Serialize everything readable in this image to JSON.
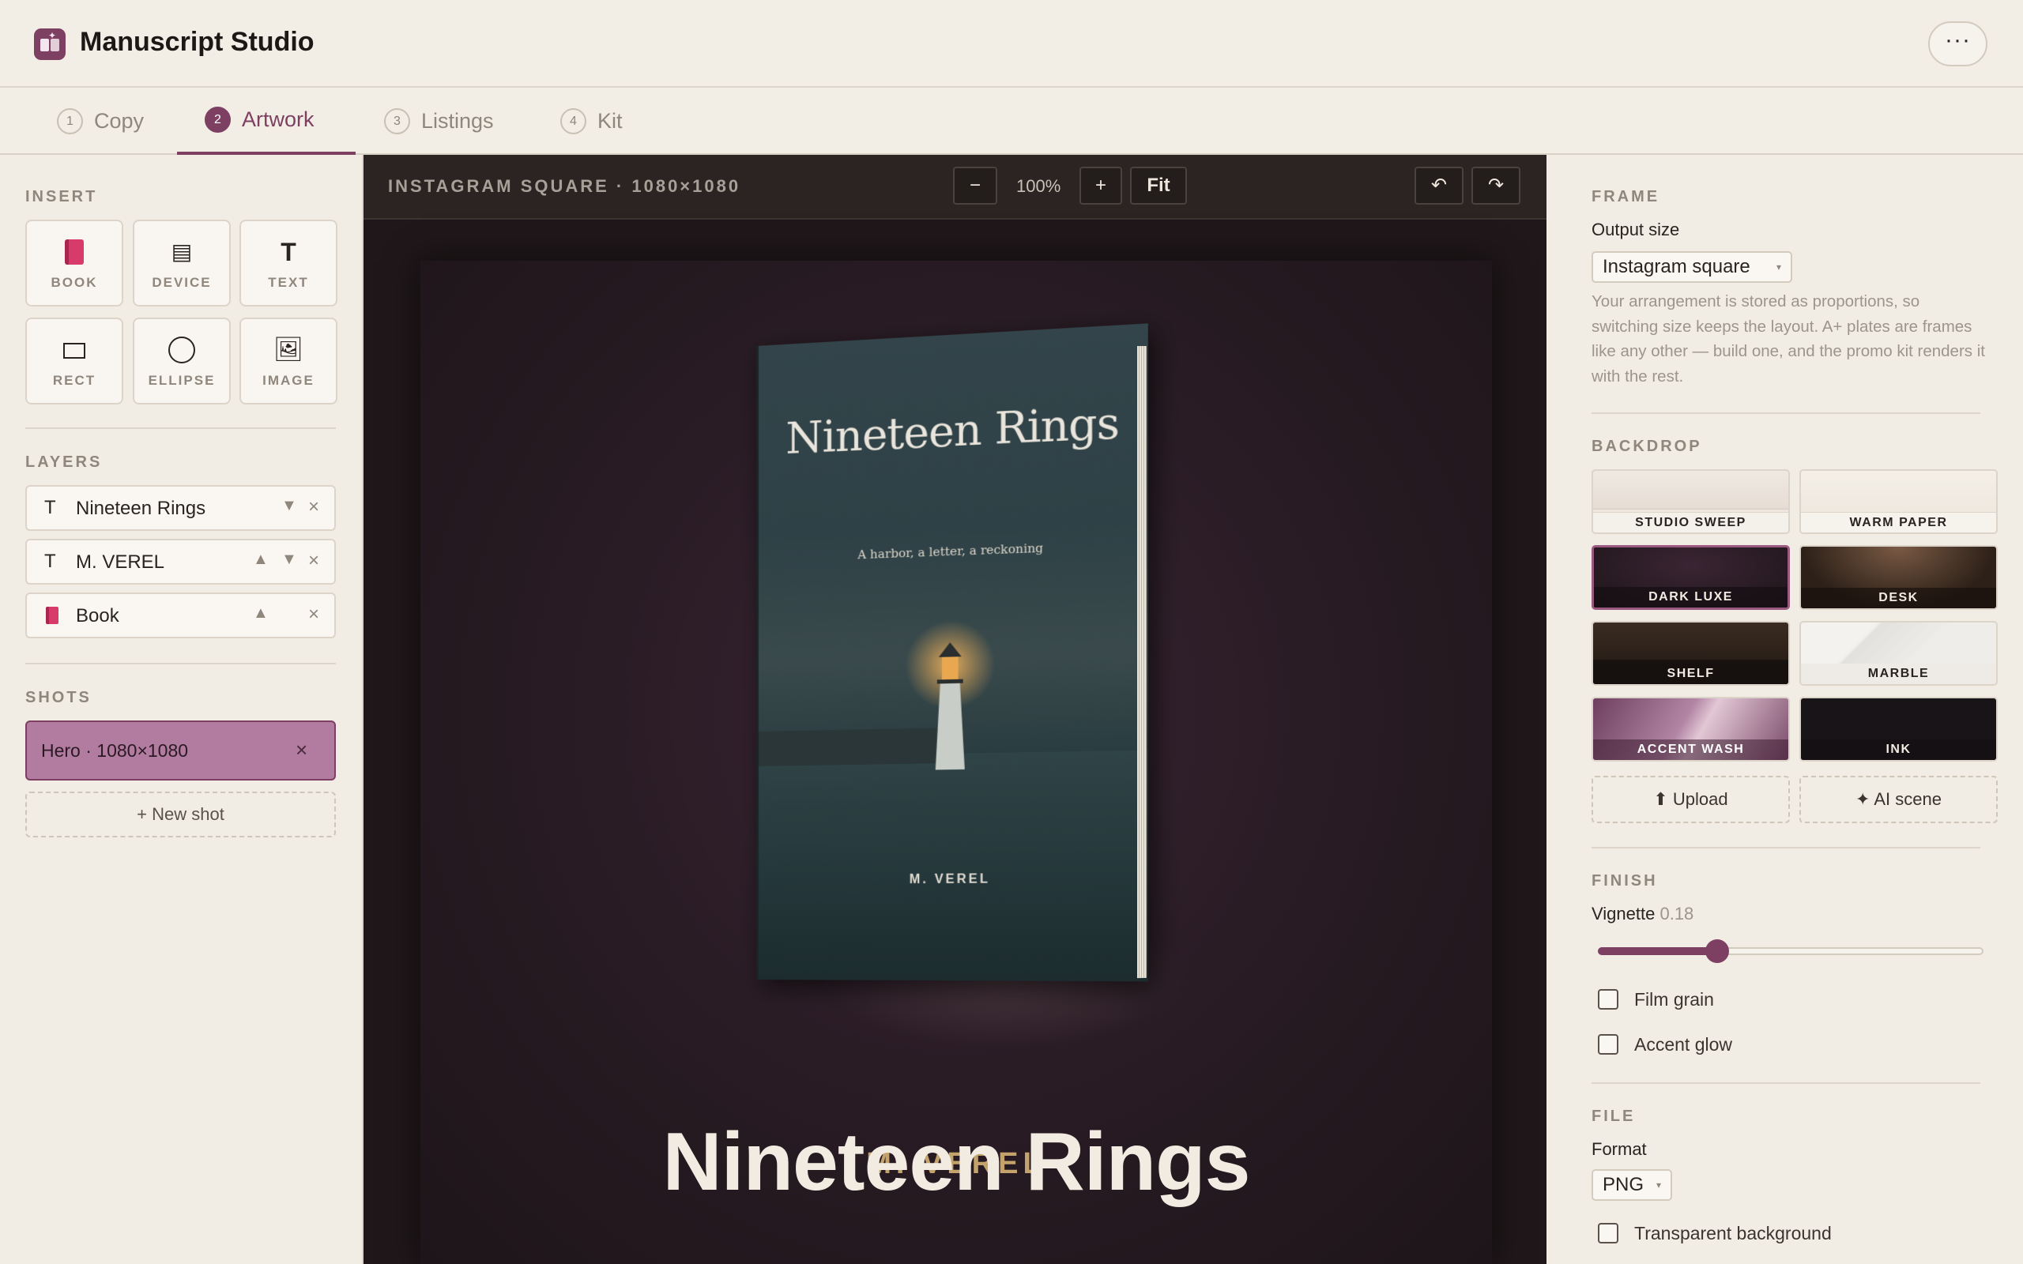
{
  "app": {
    "title": "Manuscript Studio",
    "more_label": "···"
  },
  "tabs": [
    {
      "num": "1",
      "label": "Copy"
    },
    {
      "num": "2",
      "label": "Artwork"
    },
    {
      "num": "3",
      "label": "Listings"
    },
    {
      "num": "4",
      "label": "Kit"
    }
  ],
  "active_tab": "Artwork",
  "insert": {
    "title": "INSERT",
    "items": [
      {
        "label": "BOOK",
        "icon": "book-icon"
      },
      {
        "label": "DEVICE",
        "icon": "device-icon"
      },
      {
        "label": "TEXT",
        "icon": "text-icon"
      },
      {
        "label": "RECT",
        "icon": "rect-icon"
      },
      {
        "label": "ELLIPSE",
        "icon": "ellipse-icon"
      },
      {
        "label": "IMAGE",
        "icon": "image-icon"
      }
    ]
  },
  "layers": {
    "title": "LAYERS",
    "items": [
      {
        "type": "T",
        "name": "Nineteen Rings",
        "up": "",
        "down": "▼"
      },
      {
        "type": "T",
        "name": "M. VEREL",
        "up": "▲",
        "down": "▼"
      },
      {
        "type": "book",
        "name": "Book",
        "up": "▲",
        "down": ""
      }
    ]
  },
  "shots": {
    "title": "SHOTS",
    "items": [
      {
        "name": "Hero · 1080×1080",
        "selected": true
      }
    ],
    "new_label": "+ New shot"
  },
  "canvas_toolbar": {
    "title": "INSTAGRAM SQUARE · 1080×1080",
    "zoom_out": "−",
    "zoom": "100%",
    "zoom_in": "+",
    "fit": "Fit",
    "undo": "↶",
    "redo": "↷"
  },
  "canvas": {
    "book_title": "Nineteen Rings",
    "book_subtitle": "A harbor, a letter, a reckoning",
    "book_author": "M. VEREL",
    "author_text": "M. VEREL",
    "title_text": "Nineteen Rings"
  },
  "frame": {
    "title": "FRAME",
    "output_label": "Output size",
    "output_value": "Instagram square",
    "note": "Your arrangement is stored as proportions, so switching size keeps the layout. A+ plates are frames like any other — build one, and the promo kit renders it with the rest."
  },
  "backdrop": {
    "title": "BACKDROP",
    "items": [
      {
        "label": "STUDIO SWEEP",
        "selected": false
      },
      {
        "label": "WARM PAPER",
        "selected": false
      },
      {
        "label": "DARK LUXE",
        "selected": true
      },
      {
        "label": "DESK",
        "selected": false
      },
      {
        "label": "SHELF",
        "selected": false
      },
      {
        "label": "MARBLE",
        "selected": false
      },
      {
        "label": "ACCENT WASH",
        "selected": false
      },
      {
        "label": "INK",
        "selected": false
      }
    ],
    "upload_label": "⬆ Upload",
    "ai_label": "✦ AI scene"
  },
  "finish": {
    "title": "FINISH",
    "vignette_label": "Vignette",
    "vignette_value": "0.18",
    "vignette": 0.31,
    "film_grain": {
      "label": "Film grain",
      "checked": false
    },
    "accent_glow": {
      "label": "Accent glow",
      "checked": false
    }
  },
  "file": {
    "title": "FILE",
    "format_label": "Format",
    "format_value": "PNG",
    "transparent": {
      "label": "Transparent background",
      "checked": false
    }
  },
  "colors": {
    "accent": "#7d3f62",
    "gold": "#c3a36b",
    "canvas_bg": "#2a1c25"
  }
}
